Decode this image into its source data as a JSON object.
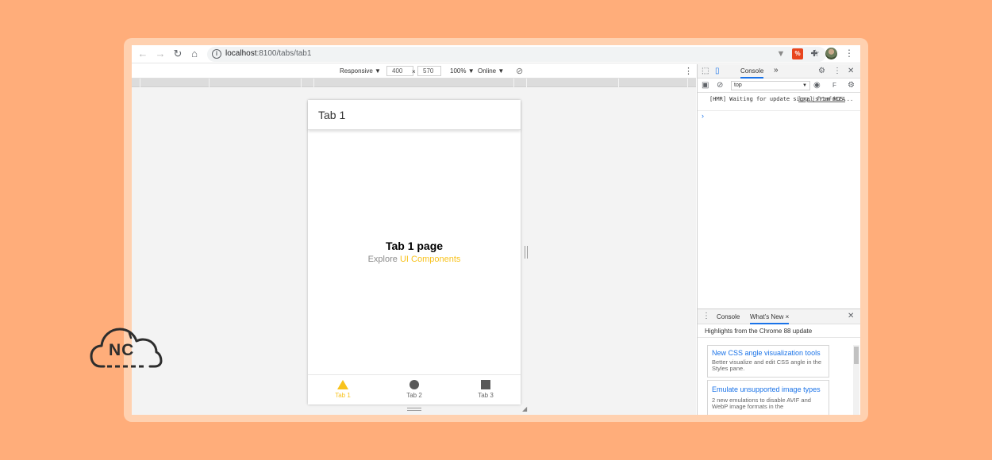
{
  "browser": {
    "url_host": "localhost",
    "url_path": ":8100/tabs/tab1",
    "icons": {
      "back": "arrow-left-icon",
      "forward": "arrow-right-icon",
      "reload": "reload-icon",
      "home": "home-icon",
      "info": "info-icon",
      "star": "star-icon",
      "ext_v": "vue-devtools-icon",
      "ext_red": "extension-icon",
      "puzzle": "puzzle-icon",
      "menu": "kebab-menu-icon"
    },
    "ext_red_label": "%"
  },
  "emulation": {
    "device": "Responsive",
    "width": "400",
    "times": "×",
    "height": "570",
    "zoom": "100%",
    "throttle": "Online",
    "caret": "▼"
  },
  "app": {
    "header_title": "Tab 1",
    "page_title": "Tab 1 page",
    "explore_text": "Explore",
    "explore_link": "UI Components",
    "accent_color": "#f8c21c",
    "tabs": [
      {
        "label": "Tab 1",
        "icon": "triangle-icon",
        "active": true
      },
      {
        "label": "Tab 2",
        "icon": "ellipse-icon",
        "active": false
      },
      {
        "label": "Tab 3",
        "icon": "square-icon",
        "active": false
      }
    ]
  },
  "devtools": {
    "tab_console": "Console",
    "more_tabs": "»",
    "context": "top",
    "filter": "F",
    "log_message": "[HMR] Waiting for update signal from WDS...",
    "log_source": "log.js?1afd:24",
    "prompt": "›",
    "drawer": {
      "tab_console": "Console",
      "tab_whats_new": "What's New",
      "close_tab": "×",
      "close": "✕",
      "subtitle": "Highlights from the Chrome 88 update",
      "cards": [
        {
          "title": "New CSS angle visualization tools",
          "desc": "Better visualize and edit CSS angle in the Styles pane."
        },
        {
          "title": "Emulate unsupported image types",
          "desc": "2 new emulations to disable AVIF and WebP image formats in the"
        }
      ]
    }
  },
  "logo": {
    "text": "NC"
  }
}
